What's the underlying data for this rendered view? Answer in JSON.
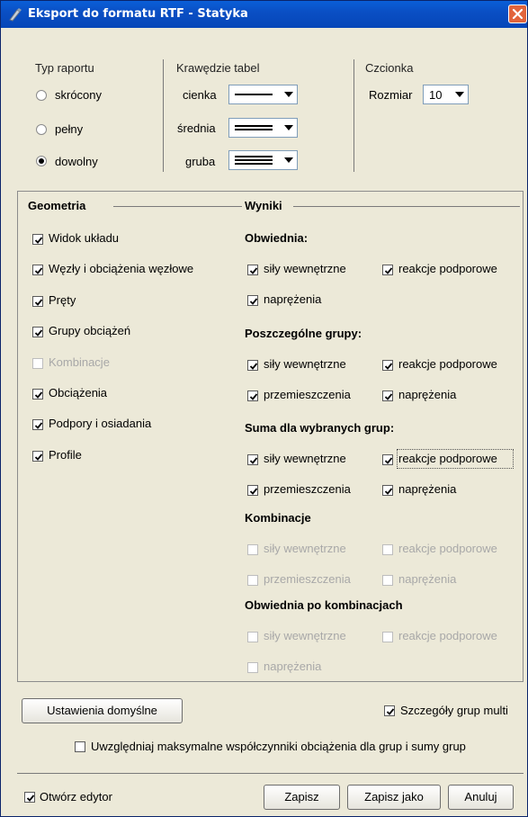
{
  "window": {
    "title": "Eksport do formatu RTF - Statyka"
  },
  "report_type": {
    "title": "Typ raportu",
    "options": [
      "skrócony",
      "pełny",
      "dowolny"
    ],
    "selected": "dowolny"
  },
  "table_borders": {
    "title": "Krawędzie tabel",
    "rows": [
      {
        "label": "cienka"
      },
      {
        "label": "średnia"
      },
      {
        "label": "gruba"
      }
    ]
  },
  "font": {
    "title": "Czcionka",
    "size_label": "Rozmiar",
    "size_value": "10"
  },
  "geometry": {
    "title": "Geometria",
    "items": [
      {
        "label": "Widok układu",
        "checked": true,
        "enabled": true
      },
      {
        "label": "Węzły i obciążenia węzłowe",
        "checked": true,
        "enabled": true
      },
      {
        "label": "Pręty",
        "checked": true,
        "enabled": true
      },
      {
        "label": "Grupy obciążeń",
        "checked": true,
        "enabled": true
      },
      {
        "label": "Kombinacje",
        "checked": false,
        "enabled": false
      },
      {
        "label": "Obciążenia",
        "checked": true,
        "enabled": true
      },
      {
        "label": "Podpory i osiadania",
        "checked": true,
        "enabled": true
      },
      {
        "label": "Profile",
        "checked": true,
        "enabled": true
      }
    ]
  },
  "results": {
    "title": "Wyniki",
    "sections": [
      {
        "title": "Obwiednia:",
        "items": [
          {
            "label": "siły wewnętrzne",
            "checked": true,
            "enabled": true
          },
          {
            "label": "reakcje podporowe",
            "checked": true,
            "enabled": true
          },
          {
            "label": "naprężenia",
            "checked": true,
            "enabled": true
          }
        ]
      },
      {
        "title": "Poszczególne grupy:",
        "items": [
          {
            "label": "siły wewnętrzne",
            "checked": true,
            "enabled": true
          },
          {
            "label": "reakcje podporowe",
            "checked": true,
            "enabled": true
          },
          {
            "label": "przemieszczenia",
            "checked": true,
            "enabled": true
          },
          {
            "label": "naprężenia",
            "checked": true,
            "enabled": true
          }
        ]
      },
      {
        "title": "Suma dla wybranych grup:",
        "items": [
          {
            "label": "siły wewnętrzne",
            "checked": true,
            "enabled": true
          },
          {
            "label": "reakcje podporowe",
            "checked": true,
            "enabled": true,
            "focused": true
          },
          {
            "label": "przemieszczenia",
            "checked": true,
            "enabled": true
          },
          {
            "label": "naprężenia",
            "checked": true,
            "enabled": true
          }
        ]
      },
      {
        "title": "Kombinacje",
        "items": [
          {
            "label": "siły wewnętrzne",
            "checked": false,
            "enabled": false
          },
          {
            "label": "reakcje podporowe",
            "checked": false,
            "enabled": false
          },
          {
            "label": "przemieszczenia",
            "checked": false,
            "enabled": false
          },
          {
            "label": "naprężenia",
            "checked": false,
            "enabled": false
          }
        ]
      },
      {
        "title": "Obwiednia po kombinacjach",
        "items": [
          {
            "label": "siły wewnętrzne",
            "checked": false,
            "enabled": false
          },
          {
            "label": "reakcje podporowe",
            "checked": false,
            "enabled": false
          },
          {
            "label": "naprężenia",
            "checked": false,
            "enabled": false
          }
        ]
      }
    ]
  },
  "bottom": {
    "defaults_button": "Ustawienia domyślne",
    "group_details": {
      "label": "Szczegóły grup multi",
      "checked": true
    },
    "max_factors": {
      "label": "Uwzględniaj maksymalne współczynniki obciążenia dla grup i sumy grup",
      "checked": false
    },
    "open_editor": {
      "label": "Otwórz edytor",
      "checked": true
    },
    "save_button": "Zapisz",
    "save_as_button": "Zapisz jako",
    "cancel_button": "Anuluj"
  },
  "colors": {
    "titlebar": "#0a4fc4",
    "dialog_bg": "#ece9d8",
    "close": "#e2643c"
  }
}
